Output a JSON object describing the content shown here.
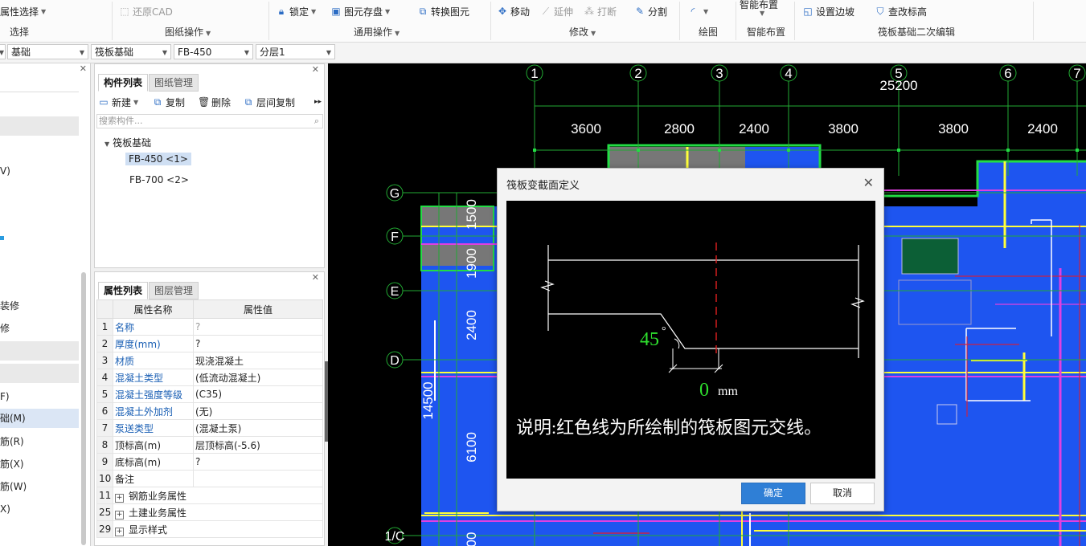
{
  "ribbon": {
    "buttons": {
      "select_prop": "属性选择",
      "restore_cad": "还原CAD",
      "lock": "锁定",
      "save_element": "图元存盘",
      "convert_element": "转换图元",
      "move": "移动",
      "extend": "延伸",
      "break": "打断",
      "split": "分割",
      "smart_layout": "智能布置",
      "set_slope_edge": "设置边坡",
      "change_elevation": "查改标高"
    },
    "groups": {
      "select": "选择",
      "drawing_ops": "图纸操作",
      "common_ops": "通用操作",
      "modify": "修改",
      "draw": "绘图",
      "smart_layout": "智能布置",
      "raft_edit": "筏板基础二次编辑"
    }
  },
  "selectors": {
    "category": "基础",
    "type": "筏板基础",
    "component": "FB-450",
    "layer": "分层1"
  },
  "left_nav": {
    "items": [
      "V)",
      "装修",
      "修",
      "F)",
      "础(M)",
      "筋(R)",
      "筋(X)",
      "筋(W)",
      "X)"
    ]
  },
  "component_panel": {
    "tabs": [
      "构件列表",
      "图纸管理"
    ],
    "toolbar": {
      "new": "新建",
      "copy": "复制",
      "delete": "删除",
      "floor_copy": "层间复制"
    },
    "search_placeholder": "搜索构件...",
    "tree_root": "筏板基础",
    "items": [
      "FB-450 <1>",
      "FB-700 <2>"
    ]
  },
  "property_panel": {
    "tabs": [
      "属性列表",
      "图层管理"
    ],
    "header": {
      "name": "属性名称",
      "value": "属性值"
    },
    "rows": [
      {
        "num": "1",
        "name": "名称",
        "value": "?"
      },
      {
        "num": "2",
        "name": "厚度(mm)",
        "value": "?"
      },
      {
        "num": "3",
        "name": "材质",
        "value": "现浇混凝土"
      },
      {
        "num": "4",
        "name": "混凝土类型",
        "value": "(低流动混凝土)"
      },
      {
        "num": "5",
        "name": "混凝土强度等级",
        "value": "(C35)"
      },
      {
        "num": "6",
        "name": "混凝土外加剂",
        "value": "(无)"
      },
      {
        "num": "7",
        "name": "泵送类型",
        "value": "(混凝土泵)"
      },
      {
        "num": "8",
        "name": "顶标高(m)",
        "value": "层顶标高(-5.6)"
      },
      {
        "num": "9",
        "name": "底标高(m)",
        "value": "?"
      },
      {
        "num": "10",
        "name": "备注",
        "value": ""
      },
      {
        "num": "11",
        "name": "钢筋业务属性",
        "value": ""
      },
      {
        "num": "25",
        "name": "土建业务属性",
        "value": ""
      },
      {
        "num": "29",
        "name": "显示样式",
        "value": ""
      }
    ]
  },
  "cad": {
    "axes_top": [
      "1",
      "2",
      "3",
      "4",
      "5",
      "6",
      "7"
    ],
    "axes_left": [
      "G",
      "F",
      "E",
      "D",
      "1/C"
    ],
    "dims_top": [
      "3600",
      "2800",
      "2400",
      "3800",
      "3800",
      "2400"
    ],
    "dim_total_top": "25200",
    "dims_left": [
      "1500",
      "1900",
      "2400",
      "6100"
    ],
    "dim_total_left": "14500",
    "dim_partial": "00",
    "colors": {
      "background": "#000000",
      "slab": "#1e55f0",
      "axis": "#16a34a",
      "yellow": "#ffff3a",
      "magenta": "#e040e0",
      "gray": "#777777"
    }
  },
  "dialog": {
    "title": "筏板变截面定义",
    "angle": "45",
    "degree": "°",
    "offset": "0",
    "unit": "mm",
    "note": "说明:红色线为所绘制的筏板图元交线。",
    "ok": "确定",
    "cancel": "取消"
  }
}
